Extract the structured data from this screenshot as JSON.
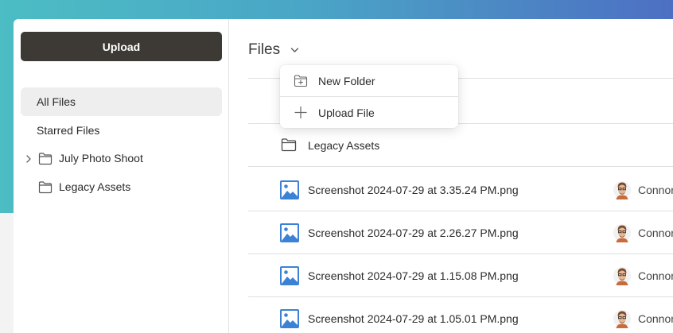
{
  "colors": {
    "accent_gradient_start": "#4cbdc4",
    "accent_gradient_end": "#4d6fc3",
    "upload_button": "#3d3935",
    "image_icon": "#3b82d6"
  },
  "sidebar": {
    "upload_label": "Upload",
    "items": [
      {
        "label": "All Files",
        "active": true
      },
      {
        "label": "Starred Files"
      },
      {
        "label": "July Photo Shoot",
        "icon": "folder-icon",
        "expandable": true
      },
      {
        "label": "Legacy Assets",
        "icon": "folder-icon"
      }
    ]
  },
  "main": {
    "title": "Files",
    "rows": [
      {
        "type": "folder",
        "name": "Legacy Assets"
      },
      {
        "type": "image",
        "name": "Screenshot 2024-07-29 at 3.35.24 PM.png",
        "owner": "Connor"
      },
      {
        "type": "image",
        "name": "Screenshot 2024-07-29 at 2.26.27 PM.png",
        "owner": "Connor"
      },
      {
        "type": "image",
        "name": "Screenshot 2024-07-29 at 1.15.08 PM.png",
        "owner": "Connor"
      },
      {
        "type": "image",
        "name": "Screenshot 2024-07-29 at 1.05.01 PM.png",
        "owner": "Connor"
      }
    ]
  },
  "dropdown": {
    "items": [
      {
        "label": "New Folder",
        "icon": "new-folder-icon"
      },
      {
        "label": "Upload File",
        "icon": "plus-icon"
      }
    ]
  }
}
